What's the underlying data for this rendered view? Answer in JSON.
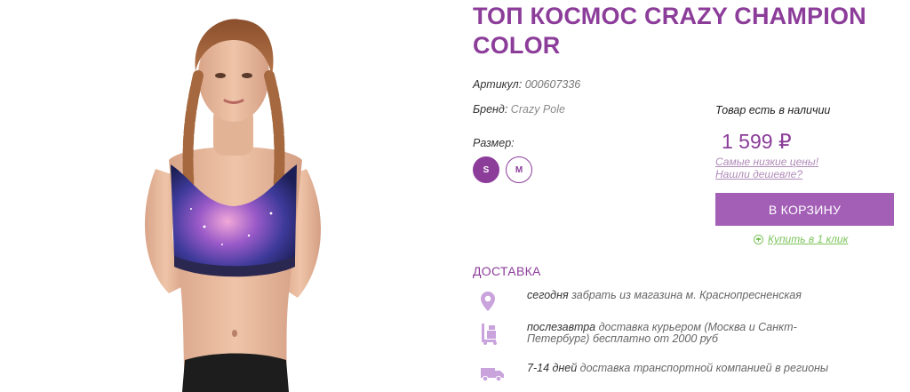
{
  "product": {
    "title": "ТОП КОСМОС CRAZY CHAMPION COLOR",
    "sku_label": "Артикул:",
    "sku_value": "000607336",
    "brand_label": "Бренд:",
    "brand_value": "Crazy Pole",
    "stock_status": "Товар есть в наличии",
    "size_label": "Размер:",
    "sizes": [
      {
        "label": "S",
        "selected": true
      },
      {
        "label": "M",
        "selected": false
      }
    ],
    "price": "1 599 ₽",
    "lowest_price_link": "Самые низкие цены!",
    "found_cheaper_link": "Нашли дешевле?",
    "cart_button": "В КОРЗИНУ",
    "one_click_link": "Купить в 1 клик"
  },
  "delivery": {
    "title": "ДОСТАВКА",
    "items": [
      {
        "icon": "location-pin-icon",
        "highlight": "сегодня",
        "text": " забрать из магазина м. Краснопресненская"
      },
      {
        "icon": "hand-truck-icon",
        "highlight": "послезавтра",
        "text": " доставка курьером (Москва и Санкт-Петербург) бесплатно от 2000 руб"
      },
      {
        "icon": "delivery-truck-icon",
        "highlight": "7-14 дней",
        "text": " доставка транспортной компанией в регионы"
      }
    ]
  },
  "colors": {
    "accent": "#8c3d9a",
    "button": "#a35fb6",
    "link_green": "#7cc35a",
    "icon_lavender": "#c9a3dc"
  }
}
